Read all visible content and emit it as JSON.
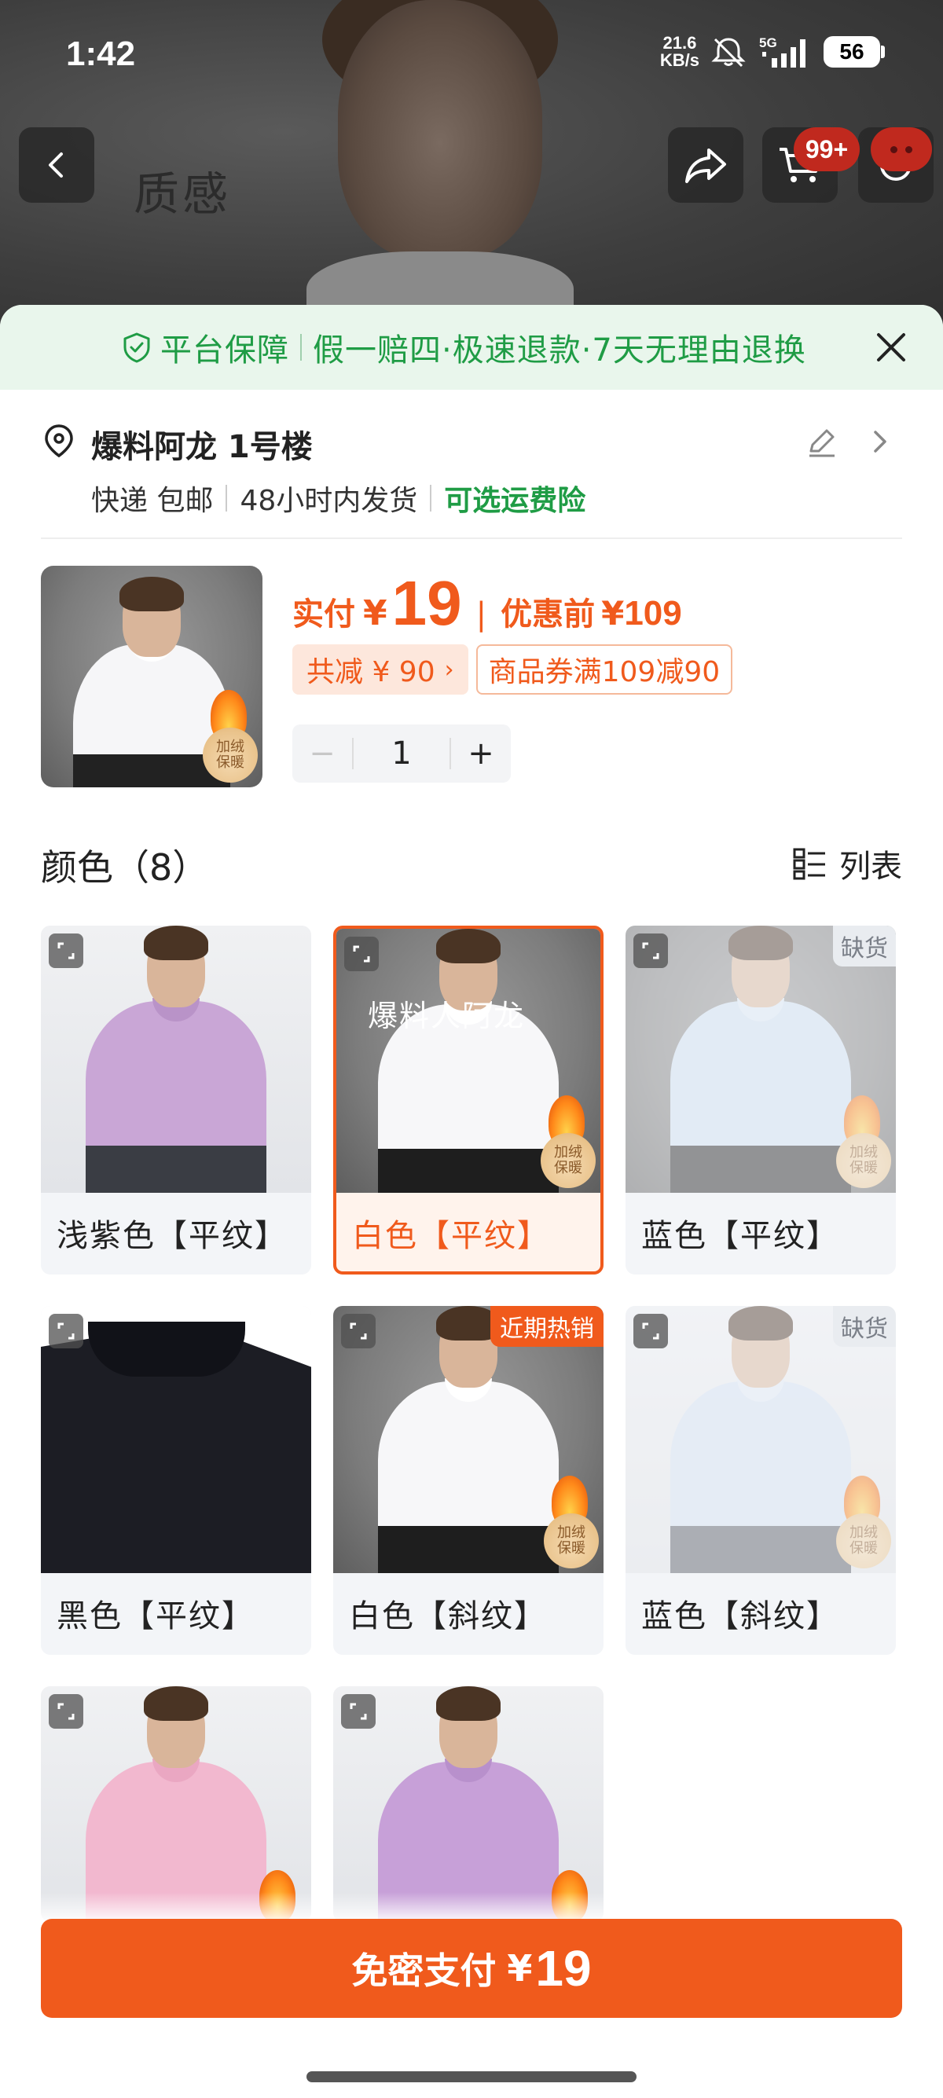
{
  "status_bar": {
    "time": "1:42",
    "net_speed_value": "21.6",
    "net_speed_unit": "KB/s",
    "network": "5G",
    "battery": "56"
  },
  "nav": {
    "cart_badge": "99+",
    "icons": [
      "back-icon",
      "share-icon",
      "cart-icon",
      "more-icon"
    ]
  },
  "guarantee": {
    "title": "平台保障",
    "items": "假一赔四·极速退款·7天无理由退换"
  },
  "address": {
    "name": "爆料阿龙 1号楼",
    "shipping_method": "快递 包邮",
    "dispatch": "48小时内发货",
    "insurance": "可选运费险"
  },
  "product": {
    "paid_label": "实付",
    "currency": "¥",
    "paid_price": "19",
    "orig_label": "优惠前",
    "orig_price": "109",
    "total_discount": "共减 ¥ 90",
    "coupon": "商品券满109减90",
    "quantity": "1",
    "thumb_badge_line1": "加绒",
    "thumb_badge_line2": "保暖"
  },
  "colors": {
    "title": "颜色（8）",
    "view_label": "列表",
    "items": [
      {
        "name": "浅紫色【平纹】",
        "tag": ""
      },
      {
        "name": "白色【平纹】",
        "tag": "",
        "watermark": "爆料人阿龙",
        "badge1": "加绒",
        "badge2": "保暖"
      },
      {
        "name": "蓝色【平纹】",
        "tag": "缺货",
        "badge1": "加绒",
        "badge2": "保暖"
      },
      {
        "name": "黑色【平纹】",
        "tag": ""
      },
      {
        "name": "白色【斜纹】",
        "tag": "近期热销",
        "badge1": "加绒",
        "badge2": "保暖"
      },
      {
        "name": "蓝色【斜纹】",
        "tag": "缺货",
        "badge1": "加绒",
        "badge2": "保暖"
      },
      {
        "name": "",
        "tag": ""
      },
      {
        "name": "",
        "tag": ""
      }
    ]
  },
  "pay_button": {
    "label": "免密支付",
    "currency": "¥",
    "amount": "19"
  },
  "colors_palette": {
    "accent_orange": "#f05a1c",
    "guarantee_green": "#1f9c45",
    "guarantee_bg": "#e9f6ec"
  }
}
